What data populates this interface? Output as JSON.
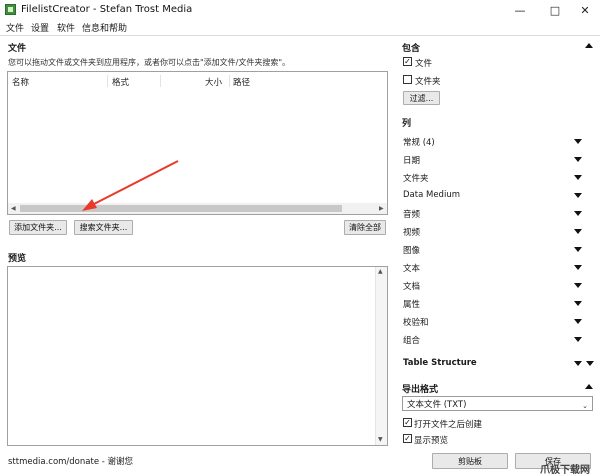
{
  "window": {
    "title": "FilelistCreator - Stefan Trost Media",
    "controls": [
      "—",
      "□",
      "✕"
    ]
  },
  "menu": [
    "文件",
    "设置",
    "软件",
    "信息和帮助"
  ],
  "files": {
    "title": "文件",
    "hint": "您可以拖动文件或文件夹到应用程序，或者你可以点击\"添加文件/文件夹搜索\"。",
    "columns": [
      "名称",
      "格式",
      "大小",
      "路径"
    ],
    "buttons": {
      "add_folder": "添加文件夹...",
      "search_folder": "搜索文件夹...",
      "clear_all": "清除全部"
    }
  },
  "preview": {
    "title": "预览"
  },
  "include": {
    "title": "包含",
    "options": [
      {
        "label": "文件",
        "checked": true
      },
      {
        "label": "文件夹",
        "checked": false
      }
    ],
    "filter_button": "过滤..."
  },
  "columns_panel": {
    "title": "列",
    "items": [
      "常规 (4)",
      "日期",
      "文件夹",
      "Data Medium",
      "音频",
      "视频",
      "图像",
      "文本",
      "文档",
      "属性",
      "校验和",
      "组合"
    ],
    "table_structure": "Table Structure"
  },
  "export": {
    "title": "导出格式",
    "format": "文本文件 (TXT)",
    "options": [
      {
        "label": "打开文件之后创建",
        "checked": true
      },
      {
        "label": "显示预览",
        "checked": true
      }
    ]
  },
  "status": {
    "text": "sttmedia.com/donate - 谢谢您",
    "clipboard_button": "剪贴板",
    "save_button": "保存"
  },
  "watermark": "爪极下载网",
  "colors": {
    "annotation_arrow": "#e8392b",
    "app_icon": "#3f8f3f"
  }
}
